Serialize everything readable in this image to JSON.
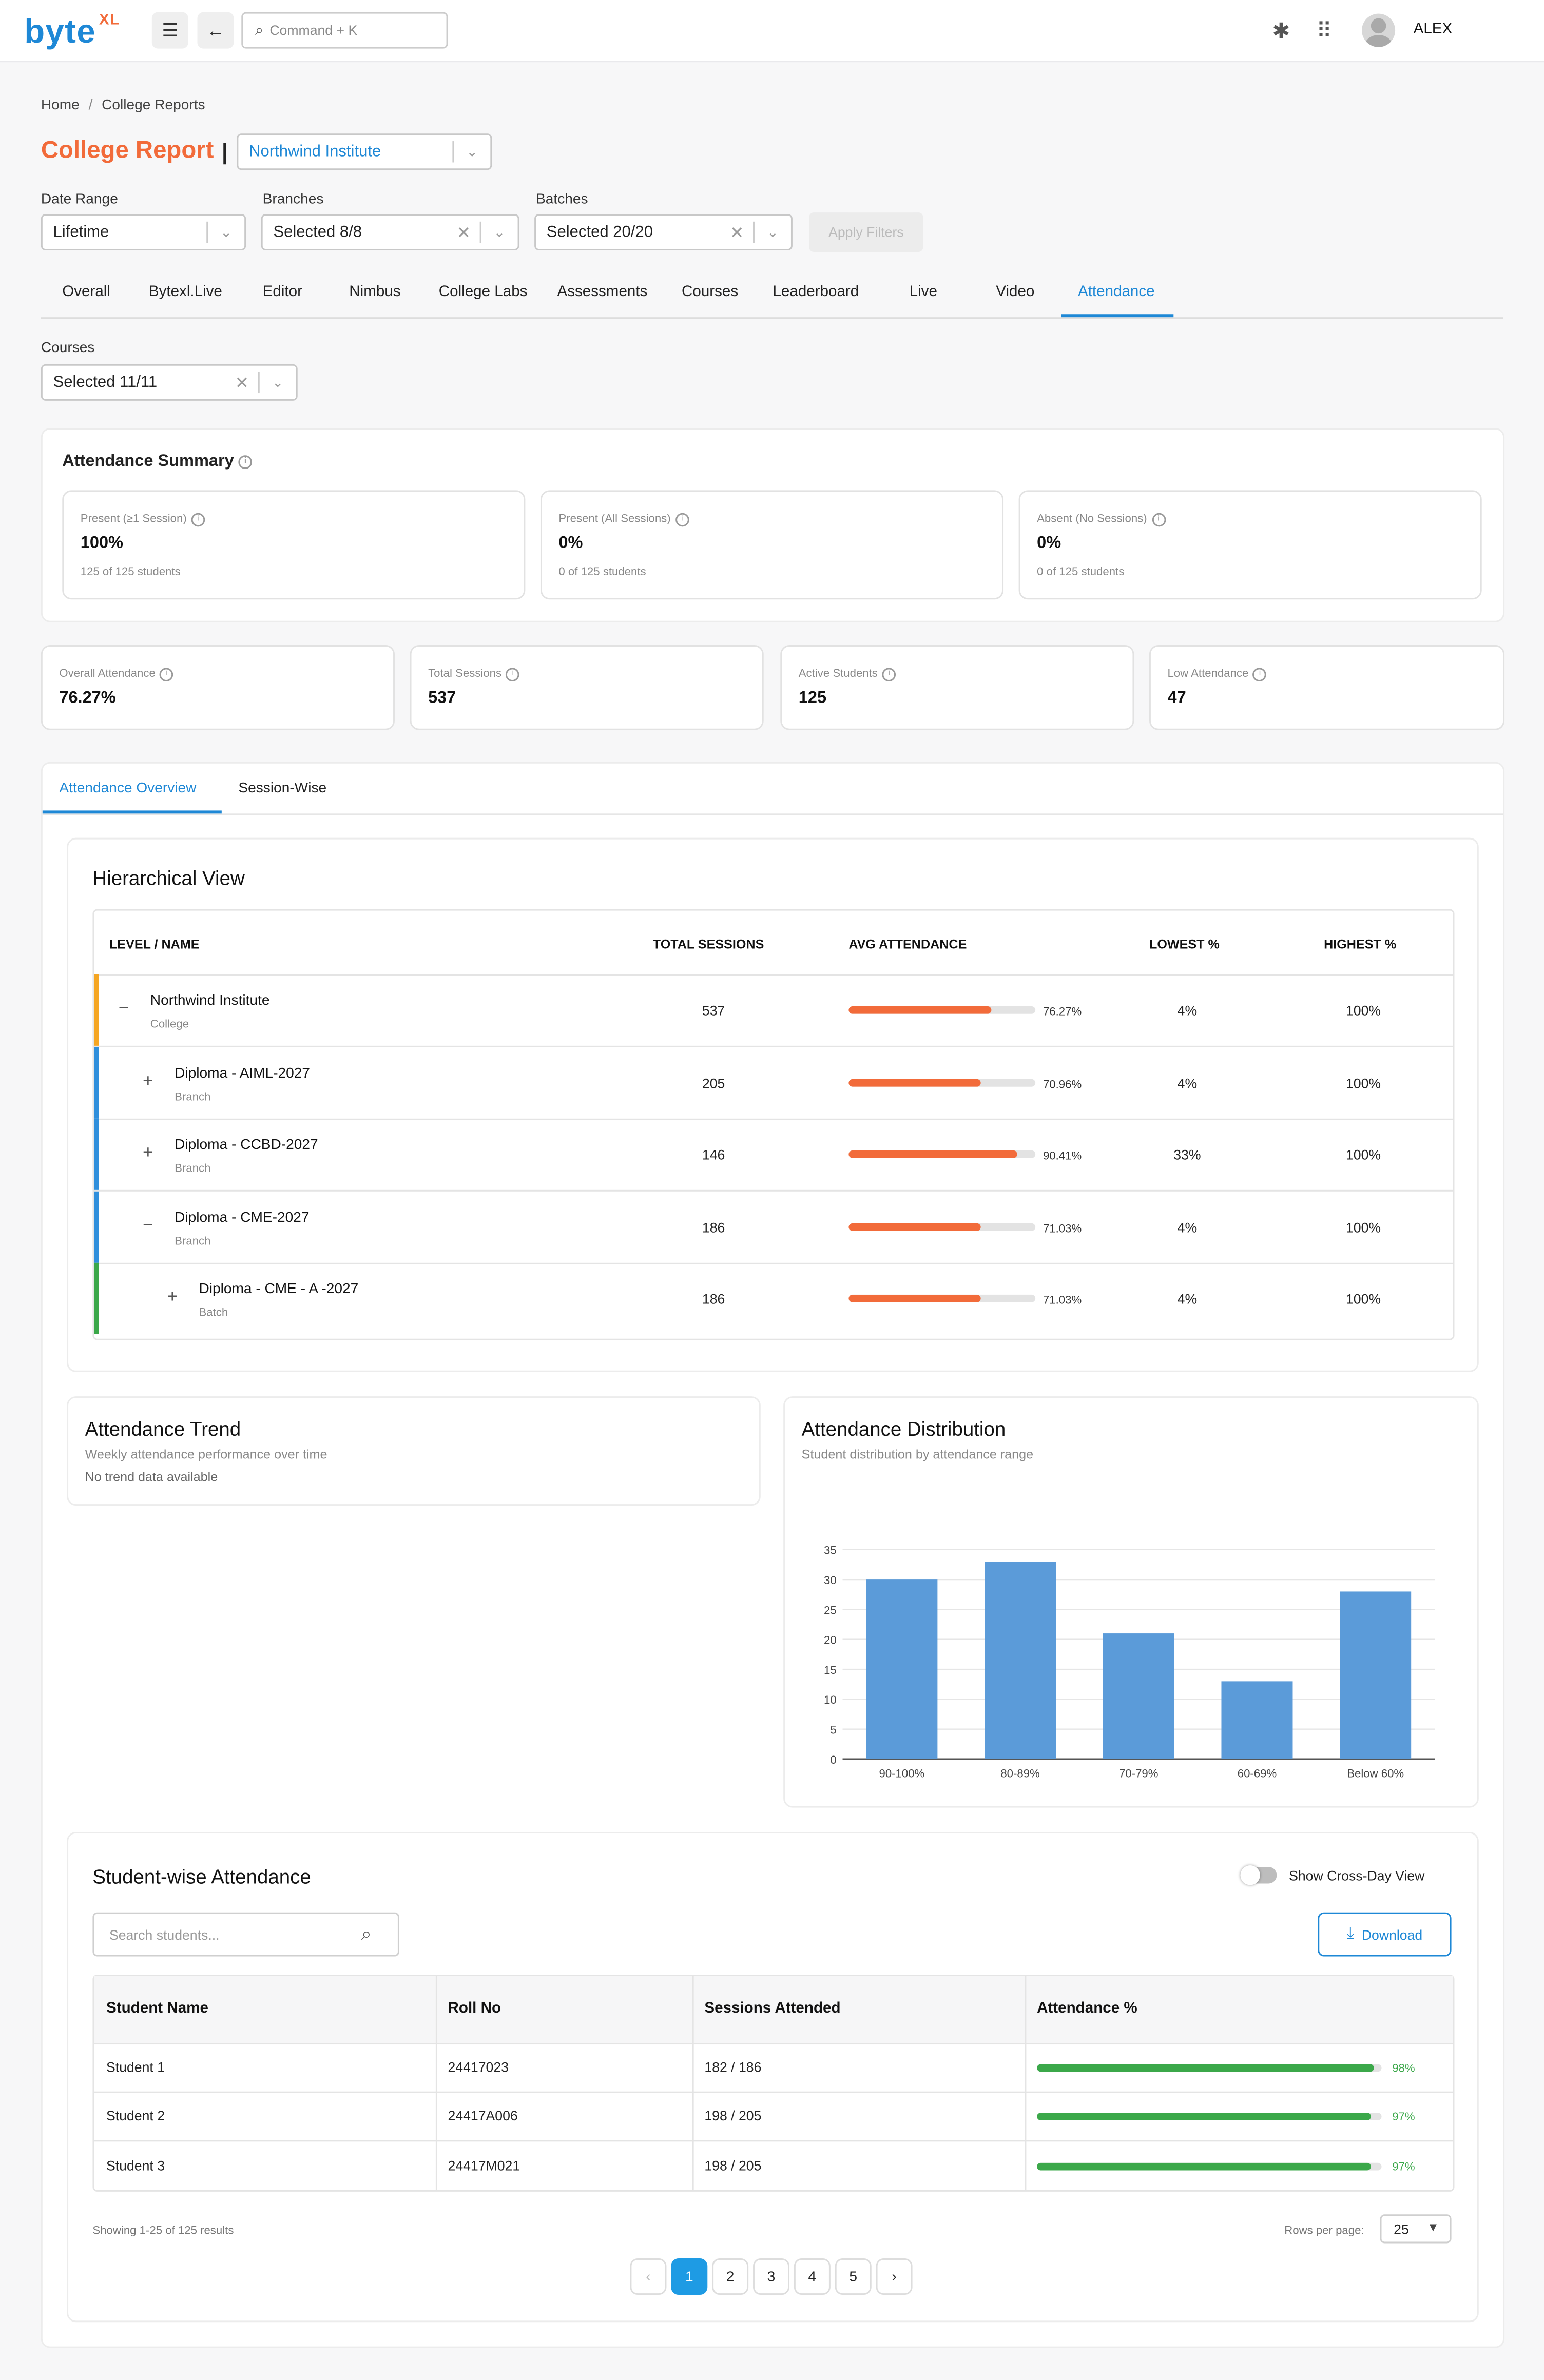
{
  "brand": {
    "name": "byte",
    "suffix": "XL"
  },
  "topbar": {
    "search_placeholder": "Command + K",
    "user_name": "ALEX"
  },
  "breadcrumb": {
    "home": "Home",
    "sep": "/",
    "current": "College Reports"
  },
  "page_title": "College Report",
  "title_divider": "|",
  "college_select": {
    "value": "Northwind Institute"
  },
  "filters": {
    "date_range": {
      "label": "Date Range",
      "value": "Lifetime"
    },
    "branches": {
      "label": "Branches",
      "value": "Selected 8/8"
    },
    "batches": {
      "label": "Batches",
      "value": "Selected 20/20"
    },
    "apply_label": "Apply Filters"
  },
  "tabs": [
    "Overall",
    "Bytexl.Live",
    "Editor",
    "Nimbus",
    "College Labs",
    "Assessments",
    "Courses",
    "Leaderboard",
    "Live",
    "Video",
    "Attendance"
  ],
  "active_tab": "Attendance",
  "courses_filter": {
    "label": "Courses",
    "value": "Selected 11/11"
  },
  "summary": {
    "title": "Attendance Summary",
    "cards": [
      {
        "label": "Present (≥1 Session)",
        "value": "100%",
        "sub": "125 of 125 students"
      },
      {
        "label": "Present (All Sessions)",
        "value": "0%",
        "sub": "0 of 125 students"
      },
      {
        "label": "Absent (No Sessions)",
        "value": "0%",
        "sub": "0 of 125 students"
      }
    ]
  },
  "kpis": [
    {
      "label": "Overall Attendance",
      "value": "76.27%"
    },
    {
      "label": "Total Sessions",
      "value": "537"
    },
    {
      "label": "Active Students",
      "value": "125"
    },
    {
      "label": "Low Attendance",
      "value": "47"
    }
  ],
  "view_tabs": {
    "overview": "Attendance Overview",
    "session": "Session-Wise"
  },
  "hierarchy": {
    "title": "Hierarchical View",
    "headers": [
      "LEVEL / NAME",
      "TOTAL SESSIONS",
      "AVG ATTENDANCE",
      "LOWEST %",
      "HIGHEST %"
    ],
    "rows": [
      {
        "name": "Northwind Institute",
        "level": "College",
        "toggle": "−",
        "sessions": "537",
        "avg_label": "76.27%",
        "avg": 76.27,
        "lowest": "4%",
        "highest": "100%",
        "stripe": "#f5a623"
      },
      {
        "name": "Diploma - AIML-2027",
        "level": "Branch",
        "toggle": "+",
        "sessions": "205",
        "avg_label": "70.96%",
        "avg": 70.96,
        "lowest": "4%",
        "highest": "100%",
        "stripe": "#2f8fdc"
      },
      {
        "name": "Diploma - CCBD-2027",
        "level": "Branch",
        "toggle": "+",
        "sessions": "146",
        "avg_label": "90.41%",
        "avg": 90.41,
        "lowest": "33%",
        "highest": "100%",
        "stripe": "#2f8fdc"
      },
      {
        "name": "Diploma - CME-2027",
        "level": "Branch",
        "toggle": "−",
        "sessions": "186",
        "avg_label": "71.03%",
        "avg": 71.03,
        "lowest": "4%",
        "highest": "100%",
        "stripe": "#2f8fdc"
      },
      {
        "name": "Diploma - CME - A -2027",
        "level": "Batch",
        "toggle": "+",
        "sessions": "186",
        "avg_label": "71.03%",
        "avg": 71.03,
        "lowest": "4%",
        "highest": "100%",
        "stripe": "#3ba84a"
      }
    ]
  },
  "trend": {
    "title": "Attendance Trend",
    "subtitle": "Weekly attendance performance over time",
    "empty": "No trend data available"
  },
  "distribution": {
    "title": "Attendance Distribution",
    "subtitle": "Student distribution by attendance range"
  },
  "chart_data": {
    "type": "bar",
    "categories": [
      "90-100%",
      "80-89%",
      "70-79%",
      "60-69%",
      "Below 60%"
    ],
    "values": [
      30,
      33,
      21,
      13,
      28
    ],
    "ylim": [
      0,
      35
    ],
    "yticks": [
      0,
      5,
      10,
      15,
      20,
      25,
      30,
      35
    ],
    "grid": true,
    "bar_color": "#5b9bd9"
  },
  "students": {
    "title": "Student-wise Attendance",
    "toggle_label": "Show Cross-Day View",
    "search_placeholder": "Search students...",
    "download_label": "Download",
    "headers": [
      "Student Name",
      "Roll No",
      "Sessions Attended",
      "Attendance %"
    ],
    "rows": [
      {
        "name": "Student 1",
        "roll": "24417023",
        "sessions": "182 / 186",
        "pct_label": "98%",
        "pct": 98
      },
      {
        "name": "Student 2",
        "roll": "24417A006",
        "sessions": "198 / 205",
        "pct_label": "97%",
        "pct": 97
      },
      {
        "name": "Student 3",
        "roll": "24417M021",
        "sessions": "198 / 205",
        "pct_label": "97%",
        "pct": 97
      }
    ],
    "results_text": "Showing 1-25 of 125 results",
    "rows_per_page_label": "Rows per page:",
    "rows_per_page": "25",
    "pages": [
      "1",
      "2",
      "3",
      "4",
      "5"
    ],
    "current_page": "1",
    "prev": "‹",
    "next": "›"
  },
  "colors": {
    "brand_blue": "#1e88d6",
    "accent_orange": "#f26b3a",
    "success_green": "#3ba84a"
  }
}
